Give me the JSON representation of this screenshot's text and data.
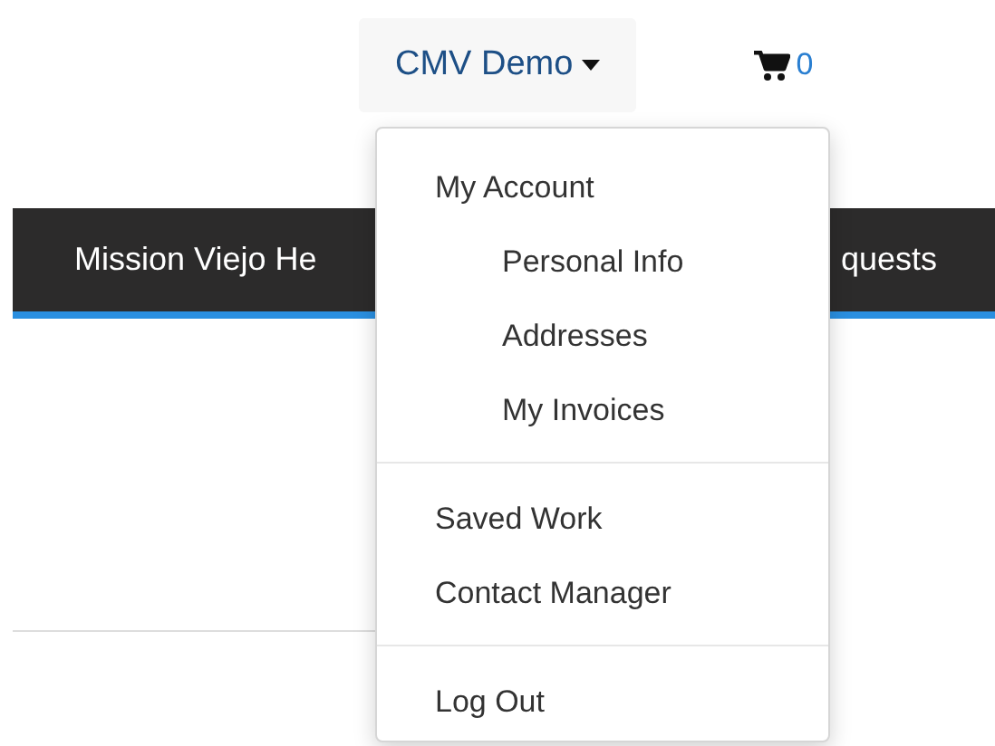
{
  "account_button": {
    "label": "CMV Demo"
  },
  "cart": {
    "count": "0"
  },
  "navbar": {
    "items": [
      "Mission Viejo He",
      "quests"
    ]
  },
  "account_menu": {
    "groups": [
      {
        "items": [
          {
            "label": "My Account",
            "children": [
              {
                "label": "Personal Info"
              },
              {
                "label": "Addresses"
              },
              {
                "label": "My Invoices"
              }
            ]
          }
        ]
      },
      {
        "items": [
          {
            "label": "Saved Work"
          },
          {
            "label": "Contact Manager"
          }
        ]
      },
      {
        "items": [
          {
            "label": "Log Out"
          }
        ]
      }
    ]
  }
}
